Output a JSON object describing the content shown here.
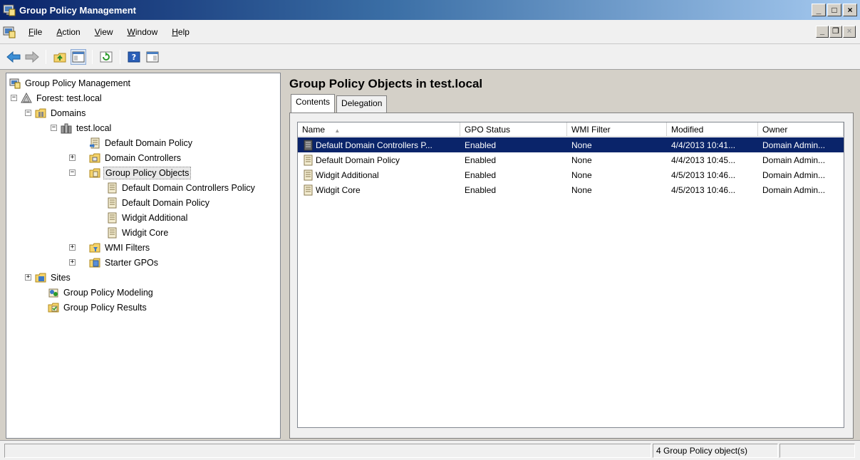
{
  "window": {
    "title": "Group Policy Management",
    "min_glyph": "_",
    "max_glyph": "□",
    "close_glyph": "×",
    "restore_glyph": "❐"
  },
  "menu": {
    "items": [
      {
        "label": "File",
        "accel": "F",
        "rest": "ile"
      },
      {
        "label": "Action",
        "accel": "A",
        "rest": "ction"
      },
      {
        "label": "View",
        "accel": "V",
        "rest": "iew"
      },
      {
        "label": "Window",
        "accel": "W",
        "rest": "indow"
      },
      {
        "label": "Help",
        "accel": "H",
        "rest": "elp"
      }
    ]
  },
  "tree": {
    "expand_plus": "+",
    "collapse_minus": "−",
    "items": [
      {
        "label": "Group Policy Management",
        "icon": "gpm-console-icon"
      },
      {
        "label": "Forest: test.local",
        "icon": "forest-icon"
      },
      {
        "label": "Domains",
        "icon": "domains-icon"
      },
      {
        "label": "test.local",
        "icon": "domain-icon"
      },
      {
        "label": "Default Domain Policy",
        "icon": "gpo-link-icon"
      },
      {
        "label": "Domain Controllers",
        "icon": "ou-icon"
      },
      {
        "label": "Group Policy Objects",
        "icon": "folder-icon"
      },
      {
        "label": "Default Domain Controllers Policy",
        "icon": "gpo-icon"
      },
      {
        "label": "Default Domain Policy",
        "icon": "gpo-icon"
      },
      {
        "label": "Widgit Additional",
        "icon": "gpo-icon"
      },
      {
        "label": "Widgit Core",
        "icon": "gpo-icon"
      },
      {
        "label": "WMI Filters",
        "icon": "wmi-folder-icon"
      },
      {
        "label": "Starter GPOs",
        "icon": "starter-folder-icon"
      },
      {
        "label": "Sites",
        "icon": "sites-icon"
      },
      {
        "label": "Group Policy Modeling",
        "icon": "modeling-icon"
      },
      {
        "label": "Group Policy Results",
        "icon": "results-icon"
      }
    ]
  },
  "right": {
    "title": "Group Policy Objects in test.local",
    "tabs": [
      "Contents",
      "Delegation"
    ],
    "columns": [
      "Name",
      "GPO Status",
      "WMI Filter",
      "Modified",
      "Owner"
    ],
    "sort_arrow": "▲",
    "rows": [
      {
        "name": "Default Domain Controllers P...",
        "status": "Enabled",
        "wmi": "None",
        "modified": "4/4/2013 10:41...",
        "owner": "Domain Admin..."
      },
      {
        "name": "Default Domain Policy",
        "status": "Enabled",
        "wmi": "None",
        "modified": "4/4/2013 10:45...",
        "owner": "Domain Admin..."
      },
      {
        "name": "Widgit Additional",
        "status": "Enabled",
        "wmi": "None",
        "modified": "4/5/2013 10:46...",
        "owner": "Domain Admin..."
      },
      {
        "name": "Widgit Core",
        "status": "Enabled",
        "wmi": "None",
        "modified": "4/5/2013 10:46...",
        "owner": "Domain Admin..."
      }
    ]
  },
  "status": {
    "count_text": "4 Group Policy object(s)"
  },
  "colors": {
    "selection": "#0a246a",
    "title_bar": "#0a246a"
  }
}
